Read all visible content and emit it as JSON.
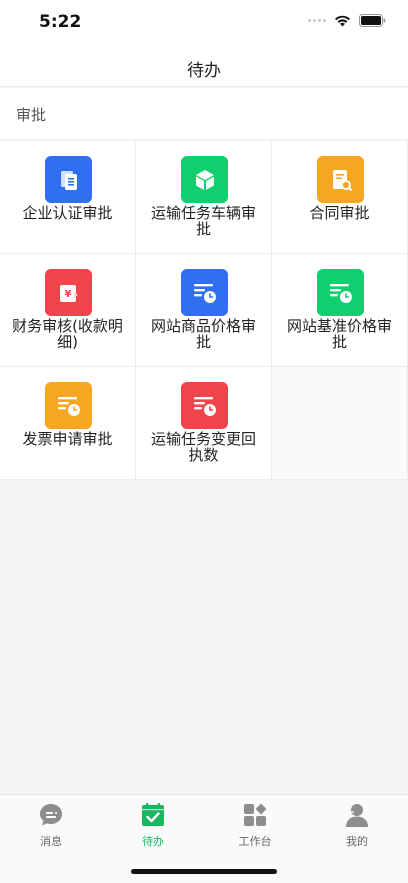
{
  "status_bar": {
    "time": "5:22"
  },
  "nav": {
    "title": "待办"
  },
  "section": {
    "title": "审批"
  },
  "grid_items": [
    {
      "label": "企业认证审批",
      "icon": "document-icon",
      "color": "#2f6ff0"
    },
    {
      "label": "运输任务车辆审批",
      "icon": "box-icon",
      "color": "#0fcf6f"
    },
    {
      "label": "合同审批",
      "icon": "contract-search-icon",
      "color": "#f6a623"
    },
    {
      "label": "财务审核(收款明细)",
      "icon": "yuan-receipt-icon",
      "color": "#f0434a"
    },
    {
      "label": "网站商品价格审批",
      "icon": "list-clock-icon",
      "color": "#2f6ff0"
    },
    {
      "label": "网站基准价格审批",
      "icon": "list-clock-icon",
      "color": "#0fcf6f"
    },
    {
      "label": "发票申请审批",
      "icon": "list-clock-icon",
      "color": "#f6a623"
    },
    {
      "label": "运输任务变更回执数",
      "icon": "list-clock-icon",
      "color": "#f0434a"
    }
  ],
  "tabs": [
    {
      "label": "消息",
      "icon": "chat-bubble-icon",
      "active": false
    },
    {
      "label": "待办",
      "icon": "calendar-check-icon",
      "active": true
    },
    {
      "label": "工作台",
      "icon": "grid-apps-icon",
      "active": false
    },
    {
      "label": "我的",
      "icon": "user-icon",
      "active": false
    }
  ],
  "colors": {
    "active_tab": "#19b85f",
    "inactive_tab": "#666666"
  }
}
